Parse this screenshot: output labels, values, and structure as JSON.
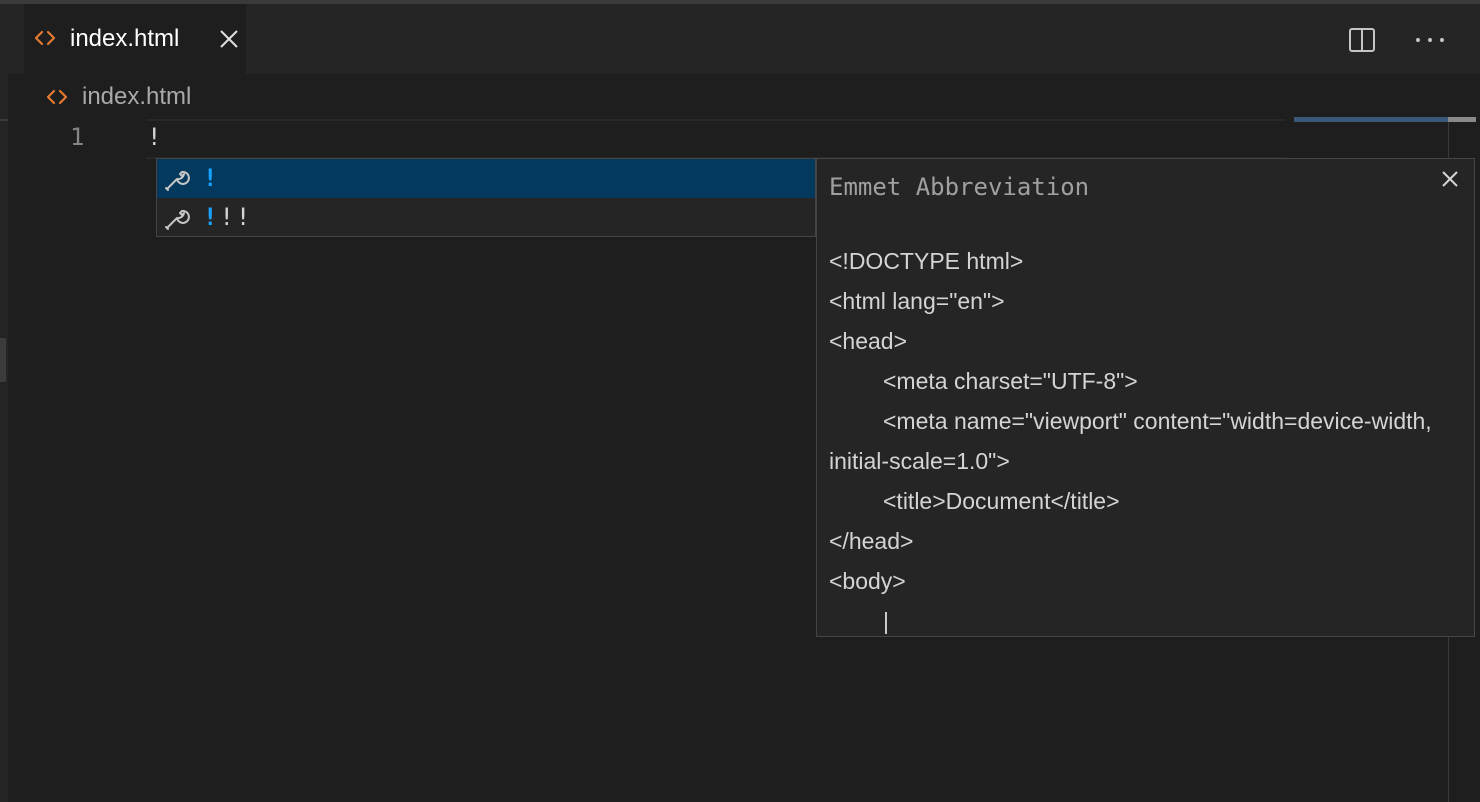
{
  "tab": {
    "label": "index.html",
    "icon": "html-file-icon"
  },
  "breadcrumb": {
    "label": "index.html"
  },
  "editor": {
    "line_number": "1",
    "line_text": "!"
  },
  "suggest": {
    "items": [
      {
        "match": "!",
        "rest": "",
        "selected": true
      },
      {
        "match": "!",
        "rest": "!!",
        "selected": false
      }
    ]
  },
  "details": {
    "title": "Emmet Abbreviation",
    "lines": [
      "<!DOCTYPE html>",
      "<html lang=\"en\">",
      "<head>",
      "<meta charset=\"UTF-8\">",
      "<meta name=\"viewport\" content=\"width=device-width, initial-scale=1.0\">",
      "<title>Document</title>",
      "</head>",
      "<body>",
      "|"
    ]
  },
  "colors": {
    "accent": "#18a3ff",
    "selection": "#04395e",
    "html_icon": "#e37933"
  }
}
